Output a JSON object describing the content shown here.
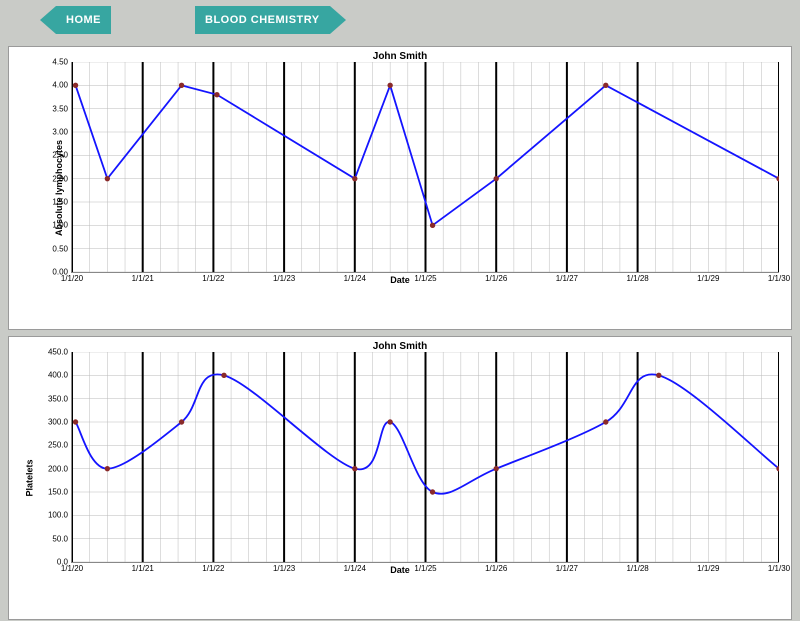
{
  "nav": {
    "home_label": "HOME",
    "next_label": "BLOOD CHEMISTRY"
  },
  "patient_name": "John Smith",
  "x_axis_label": "Date",
  "chart_data": [
    {
      "type": "line",
      "title": "John Smith",
      "xlabel": "Date",
      "ylabel": "Absolute lymphocytes",
      "ylim": [
        0.0,
        4.5
      ],
      "yticks": [
        0.0,
        0.5,
        1.0,
        1.5,
        2.0,
        2.5,
        3.0,
        3.5,
        4.0,
        4.5
      ],
      "ytick_labels": [
        "0.00",
        "0.50",
        "1.00",
        "1.50",
        "2.00",
        "2.50",
        "3.00",
        "3.50",
        "4.00",
        "4.50"
      ],
      "xlim": [
        2020.0,
        2030.0
      ],
      "xticks": [
        2020,
        2021,
        2022,
        2023,
        2024,
        2025,
        2026,
        2027,
        2028,
        2029,
        2030
      ],
      "xtick_labels": [
        "1/1/20",
        "1/1/21",
        "1/1/22",
        "1/1/23",
        "1/1/24",
        "1/1/25",
        "1/1/26",
        "1/1/27",
        "1/1/28",
        "1/1/29",
        "1/1/30"
      ],
      "major_gridlines_x": [
        2020,
        2021,
        2022,
        2023,
        2024,
        2025,
        2026,
        2027,
        2028,
        2030
      ],
      "x": [
        2020.05,
        2020.5,
        2021.55,
        2022.05,
        2024.0,
        2024.5,
        2025.1,
        2026.0,
        2027.55,
        2030.0
      ],
      "values": [
        4.0,
        2.0,
        4.0,
        3.8,
        2.0,
        4.0,
        1.0,
        2.0,
        4.0,
        2.0
      ]
    },
    {
      "type": "line",
      "title": "John Smith",
      "xlabel": "Date",
      "ylabel": "Platelets",
      "ylim": [
        0.0,
        450.0
      ],
      "yticks": [
        0,
        50,
        100,
        150,
        200,
        250,
        300,
        350,
        400,
        450
      ],
      "ytick_labels": [
        "0.0",
        "50.0",
        "100.0",
        "150.0",
        "200.0",
        "250.0",
        "300.0",
        "350.0",
        "400.0",
        "450.0"
      ],
      "xlim": [
        2020.0,
        2030.0
      ],
      "xticks": [
        2020,
        2021,
        2022,
        2023,
        2024,
        2025,
        2026,
        2027,
        2028,
        2029,
        2030
      ],
      "xtick_labels": [
        "1/1/20",
        "1/1/21",
        "1/1/22",
        "1/1/23",
        "1/1/24",
        "1/1/25",
        "1/1/26",
        "1/1/27",
        "1/1/28",
        "1/1/29",
        "1/1/30"
      ],
      "major_gridlines_x": [
        2020,
        2021,
        2022,
        2023,
        2024,
        2025,
        2026,
        2027,
        2028,
        2030
      ],
      "x": [
        2020.05,
        2020.5,
        2021.55,
        2022.15,
        2024.0,
        2024.5,
        2025.1,
        2026.0,
        2027.55,
        2028.3,
        2030.0
      ],
      "values": [
        300,
        200,
        300,
        400,
        200,
        300,
        150,
        200,
        300,
        400,
        200
      ]
    }
  ]
}
